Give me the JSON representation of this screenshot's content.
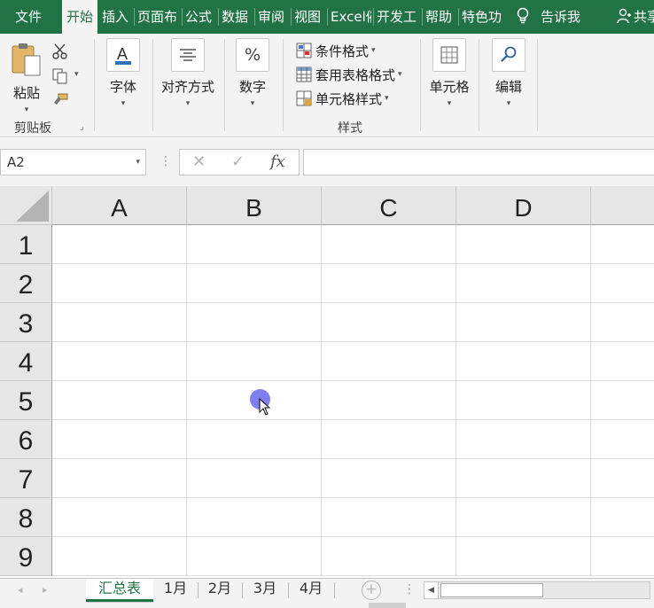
{
  "ribbon_tabs": [
    "文件",
    "开始",
    "插入",
    "页面布",
    "公式",
    "数据",
    "审阅",
    "视图",
    "Excel催",
    "开发工",
    "帮助",
    "特色功"
  ],
  "tell_me": "告诉我",
  "share": "共享",
  "groups": {
    "clipboard": {
      "paste_label": "粘贴",
      "group_label": "剪贴板"
    },
    "font": {
      "label": "字体"
    },
    "alignment": {
      "label": "对齐方式"
    },
    "number": {
      "label": "数字"
    },
    "styles": {
      "conditional_formatting": "条件格式",
      "format_as_table": "套用表格格式",
      "cell_styles": "单元格样式",
      "group_label": "样式"
    },
    "cells": {
      "label": "单元格"
    },
    "editing": {
      "label": "编辑"
    }
  },
  "formula_bar": {
    "name_box": "A2",
    "cancel_symbol": "✕",
    "enter_symbol": "✓",
    "fx_symbol": "fx",
    "content": ""
  },
  "columns": [
    "A",
    "B",
    "C",
    "D"
  ],
  "rows": [
    "1",
    "2",
    "3",
    "4",
    "5",
    "6",
    "7",
    "8",
    "9"
  ],
  "sheets": [
    "汇总表",
    "1月",
    "2月",
    "3月",
    "4月"
  ],
  "active_sheet": "汇总表",
  "colors": {
    "accent": "#217346",
    "cursor": "#7f7ff0"
  }
}
